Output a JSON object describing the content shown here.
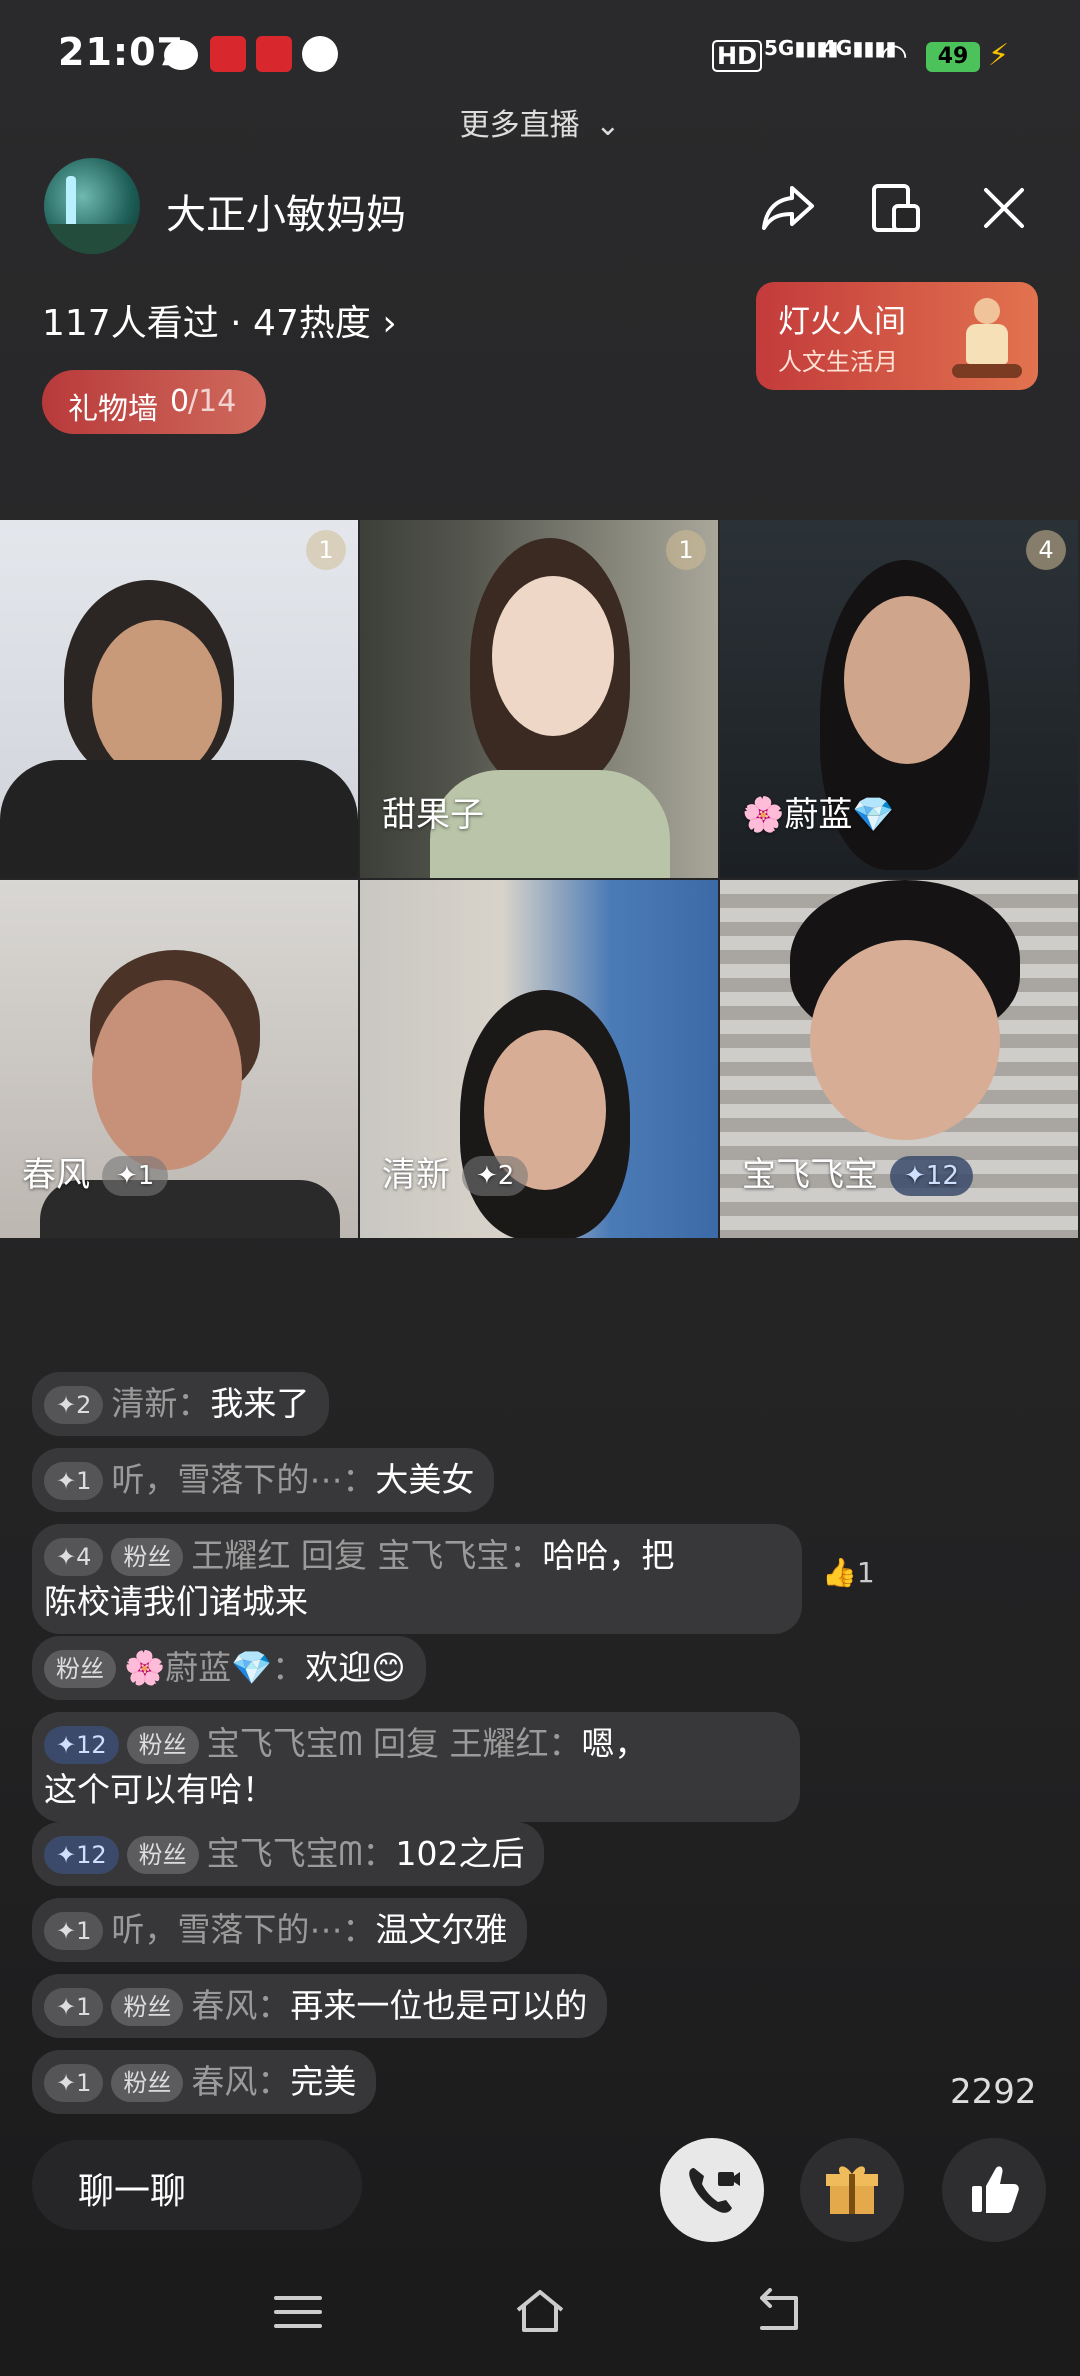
{
  "status_bar": {
    "time": "21:07",
    "battery": "49"
  },
  "header": {
    "more_live": "更多直播",
    "host_name": "大正小敏妈妈",
    "stats": "117人看过 · 47热度",
    "gift_wall_label": "礼物墙",
    "gift_wall_count": "0",
    "gift_wall_total": "/14",
    "promo_title": "灯火人间",
    "promo_subtitle": "人文生活月"
  },
  "tiles": [
    {
      "name": "",
      "count": "1"
    },
    {
      "name": "甜果子",
      "count": "1"
    },
    {
      "name": "🌸蔚蓝💎",
      "count": "4"
    },
    {
      "name": "春风",
      "level": "✦1"
    },
    {
      "name": "清新",
      "level": "✦2"
    },
    {
      "name": "宝飞飞宝",
      "level": "✦12"
    }
  ],
  "chat": [
    {
      "level": "✦2",
      "user": "清新：",
      "text": "我来了"
    },
    {
      "level": "✦1",
      "user": "听，雪落下的⋯：",
      "text": "大美女"
    },
    {
      "level": "✦4",
      "fan": "粉丝",
      "user": "王耀红 回复 宝飞飞宝：",
      "text": "哈哈，把",
      "text2": "陈校请我们诸城来",
      "likes": "1"
    },
    {
      "fan": "粉丝",
      "user": "🌸蔚蓝💎：",
      "text": "欢迎😊"
    },
    {
      "level": "✦12",
      "fan": "粉丝",
      "user": "宝飞飞宝ᗰ 回复 王耀红：",
      "text": "嗯，",
      "text2": "这个可以有哈！"
    },
    {
      "level": "✦12",
      "fan": "粉丝",
      "user": "宝飞飞宝ᗰ：",
      "text": "102之后"
    },
    {
      "level": "✦1",
      "user": "听，雪落下的⋯：",
      "text": "温文尔雅"
    },
    {
      "level": "✦1",
      "fan": "粉丝",
      "user": "春风：",
      "text": "再来一位也是可以的"
    },
    {
      "level": "✦1",
      "fan": "粉丝",
      "user": "春风：",
      "text": "完美"
    }
  ],
  "bottom": {
    "like_count": "2292",
    "chat_placeholder": "聊一聊"
  },
  "icons": [
    "wechat-icon",
    "share-icon",
    "pip-icon",
    "close-icon",
    "chevron-right-icon",
    "chevron-down-icon",
    "call-icon",
    "gift-icon",
    "thumbs-up-icon",
    "menu-icon",
    "home-icon",
    "back-icon"
  ],
  "colors": {
    "accent_red": "#c33b3b",
    "blue_badge": "#3b4a6b",
    "battery_green": "#4cc25a"
  }
}
